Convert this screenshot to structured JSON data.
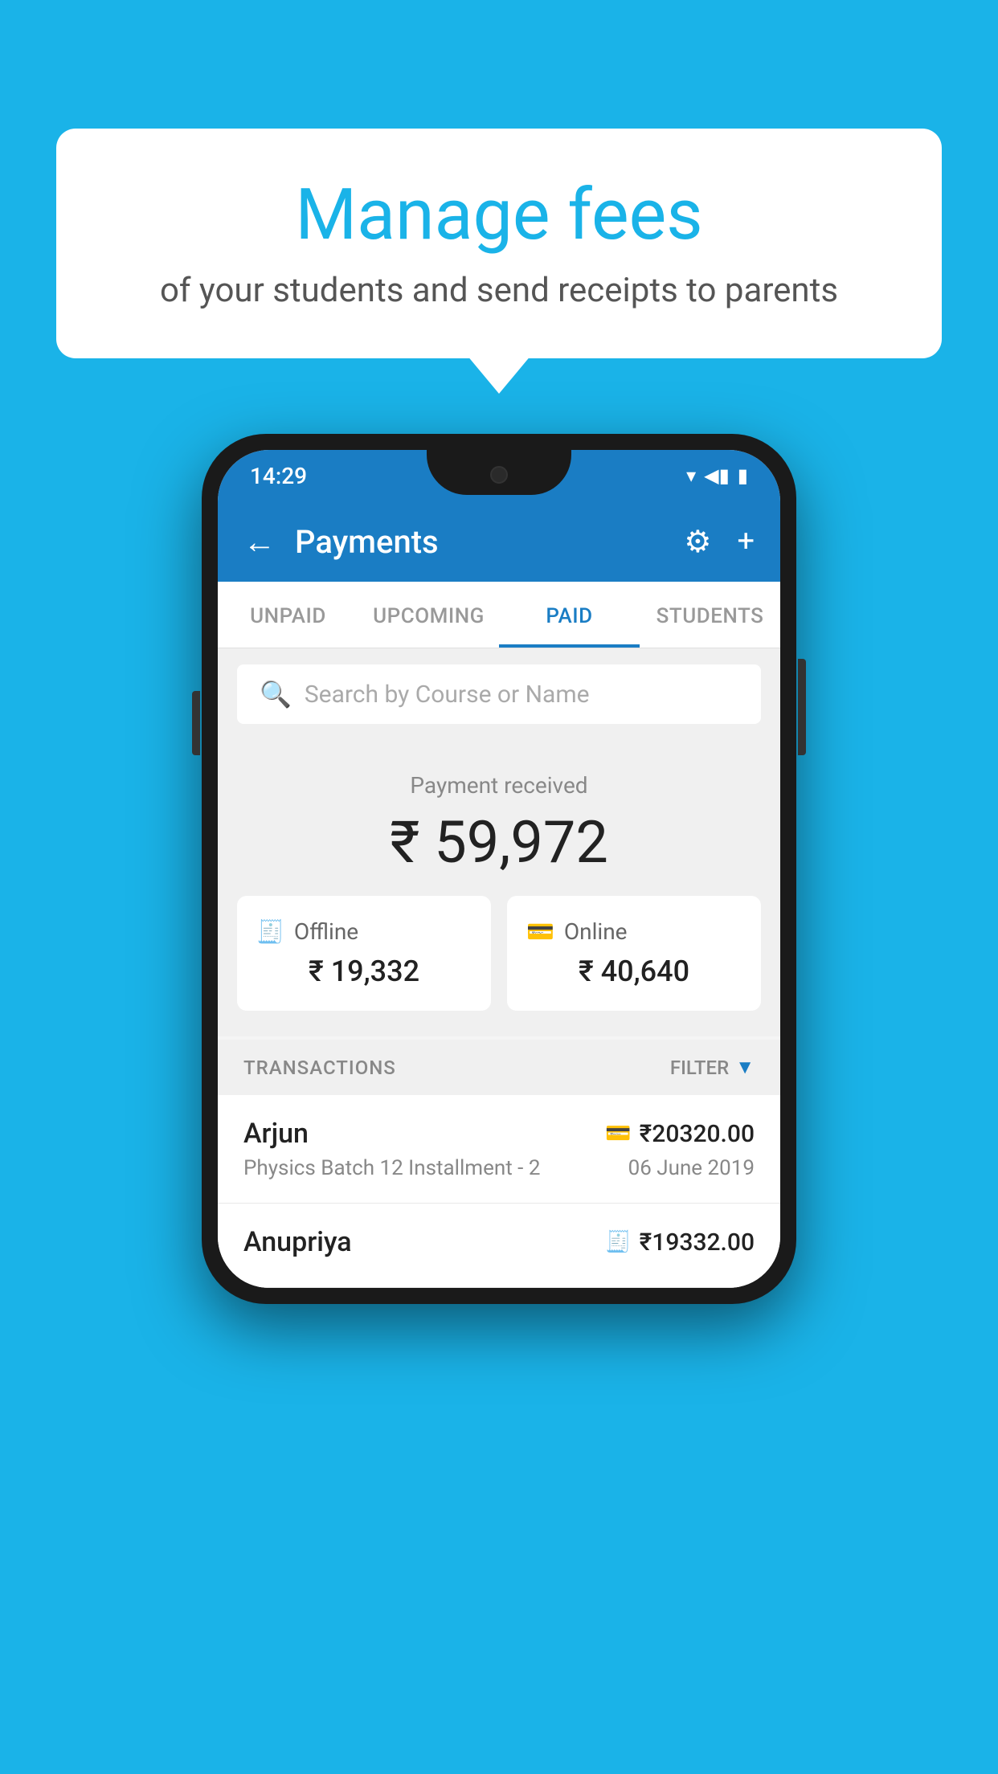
{
  "background_color": "#1ab3e8",
  "bubble": {
    "title": "Manage fees",
    "subtitle": "of your students and send receipts to parents"
  },
  "phone": {
    "status_bar": {
      "time": "14:29",
      "wifi": "▾",
      "signal": "▲",
      "battery": "▮"
    },
    "app_bar": {
      "title": "Payments",
      "back_label": "←",
      "gear_label": "⚙",
      "plus_label": "+"
    },
    "tabs": [
      {
        "label": "UNPAID",
        "active": false
      },
      {
        "label": "UPCOMING",
        "active": false
      },
      {
        "label": "PAID",
        "active": true
      },
      {
        "label": "STUDENTS",
        "active": false
      }
    ],
    "search": {
      "placeholder": "Search by Course or Name"
    },
    "payment_summary": {
      "label": "Payment received",
      "amount": "₹ 59,972",
      "offline": {
        "type": "Offline",
        "amount": "₹ 19,332"
      },
      "online": {
        "type": "Online",
        "amount": "₹ 40,640"
      }
    },
    "transactions": {
      "header": "TRANSACTIONS",
      "filter": "FILTER",
      "rows": [
        {
          "name": "Arjun",
          "amount": "₹20320.00",
          "course": "Physics Batch 12 Installment - 2",
          "date": "06 June 2019",
          "payment_type": "online"
        },
        {
          "name": "Anupriya",
          "amount": "₹19332.00",
          "course": "",
          "date": "",
          "payment_type": "offline"
        }
      ]
    }
  }
}
